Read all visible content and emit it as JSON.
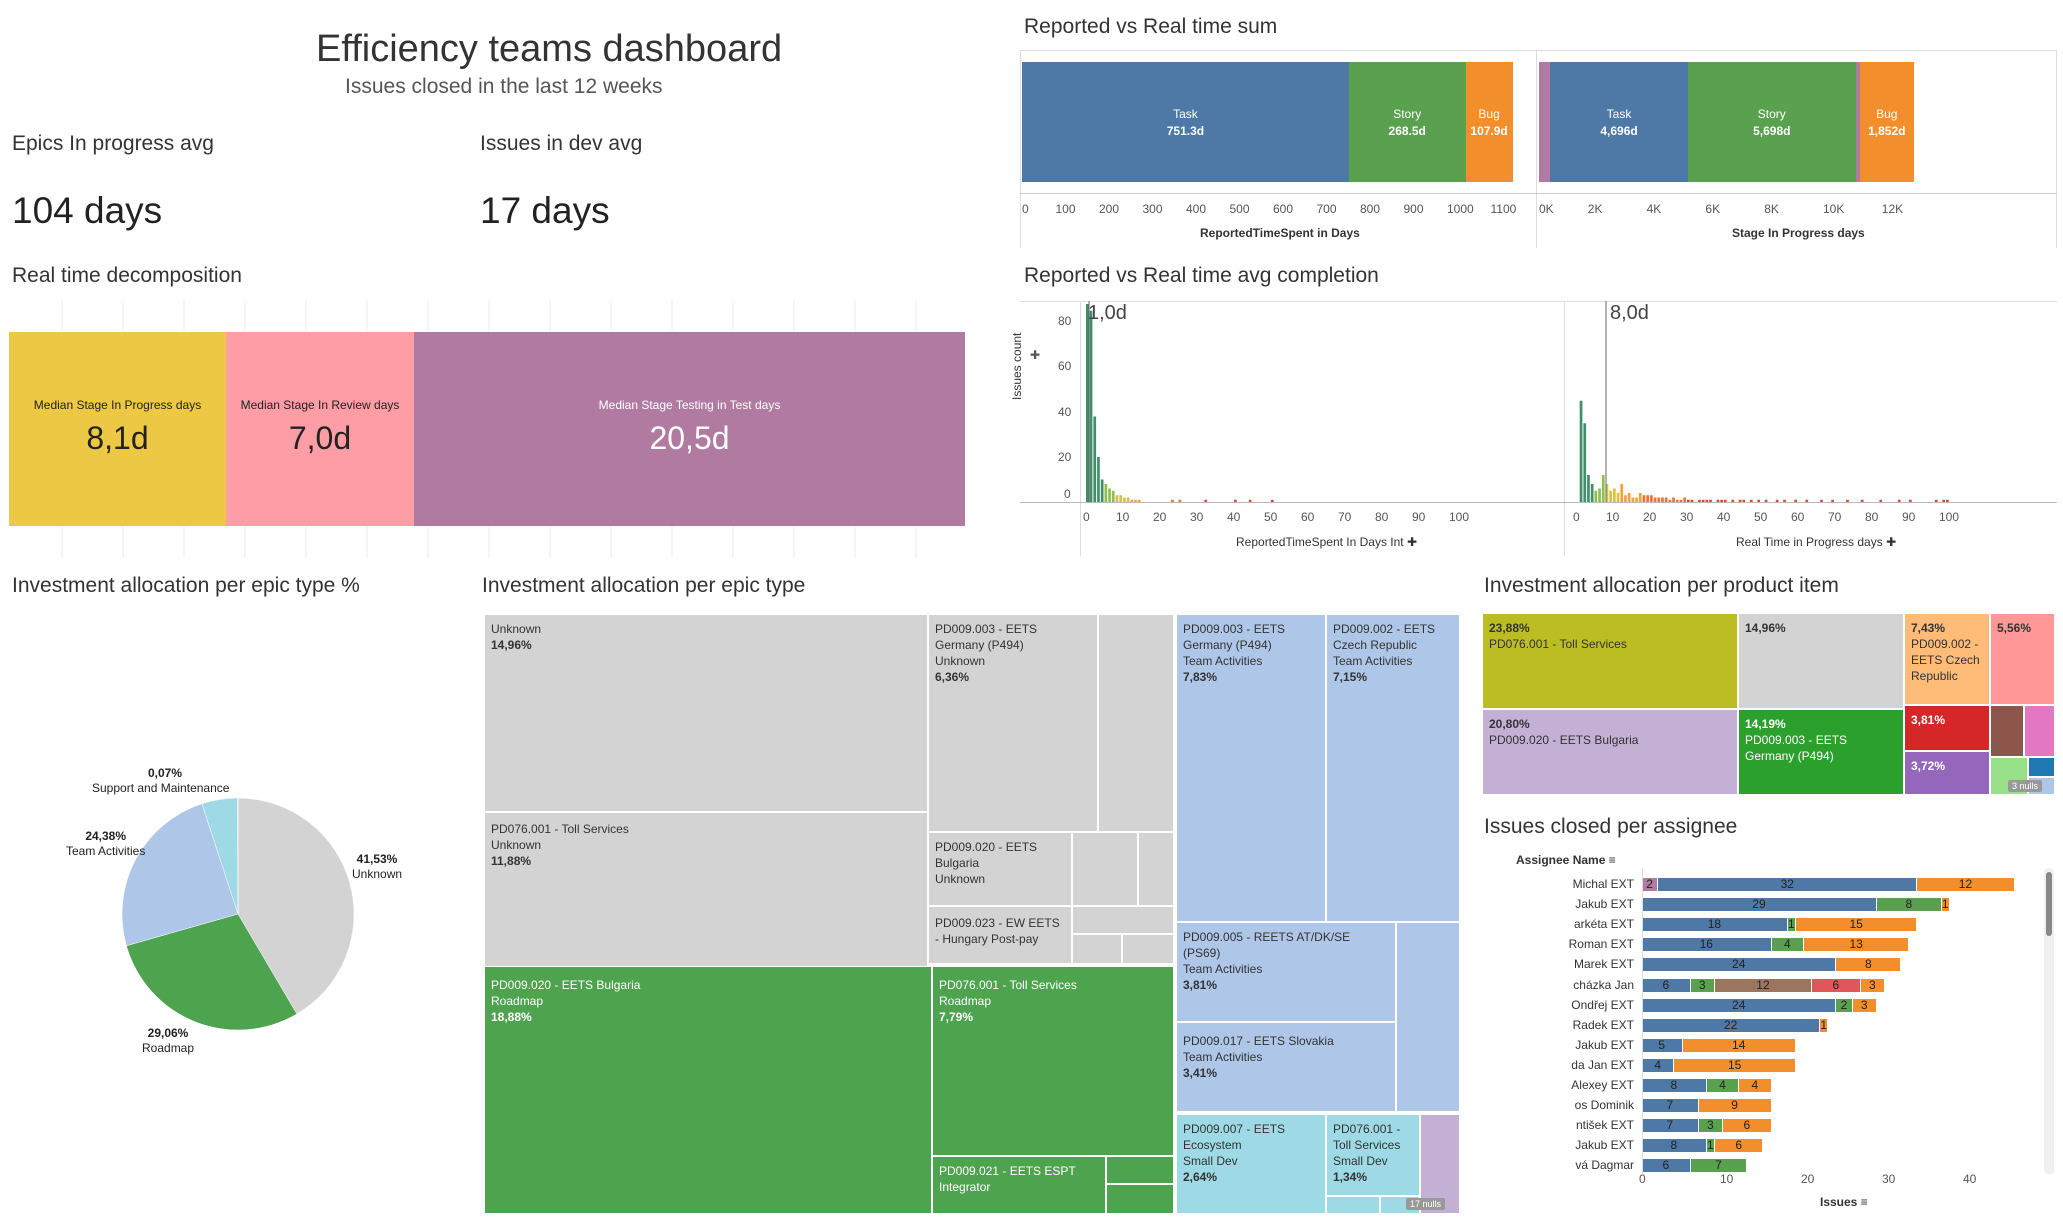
{
  "header": {
    "title": "Efficiency teams dashboard",
    "subtitle": "Issues closed in the last 12 weeks"
  },
  "kpis": {
    "epics_label": "Epics In progress avg",
    "epics_value": "104 days",
    "issues_label": "Issues in dev avg",
    "issues_value": "17 days"
  },
  "decomposition": {
    "title": "Real time decomposition",
    "segments": [
      {
        "label": "Median Stage In Progress days",
        "value": "8,1d",
        "color": "#ecc844"
      },
      {
        "label": "Median Stage In Review days",
        "value": "7,0d",
        "color": "#ff9da6"
      },
      {
        "label": "Median Stage Testing in Test days",
        "value": "20,5d",
        "color": "#b07aa1"
      }
    ]
  },
  "reported_sum": {
    "title": "Reported vs Real time sum",
    "left": {
      "segments": [
        {
          "name": "Task",
          "value": "751.3d",
          "days": 751.3,
          "color": "#4e79a7"
        },
        {
          "name": "Story",
          "value": "268.5d",
          "days": 268.5,
          "color": "#59a14f"
        },
        {
          "name": "Bug",
          "value": "107.9d",
          "days": 107.9,
          "color": "#f28e2b"
        }
      ],
      "ticks": [
        "0",
        "100",
        "200",
        "300",
        "400",
        "500",
        "600",
        "700",
        "800",
        "900",
        "1000",
        "1100"
      ],
      "axis_title": "ReportedTimeSpent in Days"
    },
    "right": {
      "segments": [
        {
          "name": "Task",
          "value": "4,696d",
          "days": 4696,
          "color": "#4e79a7"
        },
        {
          "name": "Story",
          "value": "5,698d",
          "days": 5698,
          "color": "#59a14f"
        },
        {
          "name": "Bug",
          "value": "1,852d",
          "days": 1852,
          "color": "#f28e2b"
        }
      ],
      "ticks": [
        "0K",
        "2K",
        "4K",
        "6K",
        "8K",
        "10K",
        "12K"
      ],
      "axis_title": "Stage In Progress days"
    }
  },
  "avg_completion": {
    "title": "Reported vs Real time avg completion",
    "y_title": "Issues count",
    "y_ticks": [
      "80",
      "60",
      "40",
      "20",
      "0"
    ],
    "left": {
      "marker": "1,0d",
      "ticks": [
        "0",
        "10",
        "20",
        "30",
        "40",
        "50",
        "60",
        "70",
        "80",
        "90",
        "100"
      ],
      "axis_title": "ReportedTimeSpent In Days Int"
    },
    "right": {
      "marker": "8,0d",
      "ticks": [
        "0",
        "10",
        "20",
        "30",
        "40",
        "50",
        "60",
        "70",
        "80",
        "90",
        "100"
      ],
      "axis_title": "Real Time in Progress days"
    }
  },
  "pie": {
    "title": "Investment allocation per epic type %",
    "slices": [
      {
        "pct": "41,53%",
        "name": "Unknown",
        "value": 41.53,
        "color": "#d3d3d3"
      },
      {
        "pct": "29,06%",
        "name": "Roadmap",
        "value": 29.06,
        "color": "#4ea34f"
      },
      {
        "pct": "24,38%",
        "name": "Team Activities",
        "value": 24.38,
        "color": "#aec7e8"
      },
      {
        "pct": "",
        "name": "",
        "value": 4.96,
        "color": "#9edae5"
      },
      {
        "pct": "0,07%",
        "name": "Support and Maintenance",
        "value": 0.07,
        "color": "#c5b0d5"
      }
    ]
  },
  "treemap_epic": {
    "title": "Investment allocation per epic type",
    "cells": [
      {
        "text": "Unknown",
        "pct": "14,96%"
      },
      {
        "text": "PD009.003 - EETS\nGermany (P494)\nUnknown",
        "pct": "6,36%"
      },
      {
        "text": "PD076.001 - Toll Services\nUnknown",
        "pct": "11,88%"
      },
      {
        "text": "PD009.020 - EETS\nBulgaria\nUnknown",
        "pct": ""
      },
      {
        "text": "PD009.023 - EW EETS\n- Hungary Post-pay",
        "pct": ""
      },
      {
        "text": "PD009.020 - EETS Bulgaria\nRoadmap",
        "pct": "18,88%"
      },
      {
        "text": "PD076.001 - Toll Services\nRoadmap",
        "pct": "7,79%"
      },
      {
        "text": "PD009.021 - EETS ESPT\nIntegrator",
        "pct": ""
      },
      {
        "text": "PD009.003 - EETS\nGermany (P494)\nTeam Activities",
        "pct": "7,83%"
      },
      {
        "text": "PD009.002 - EETS\nCzech Republic\nTeam Activities",
        "pct": "7,15%"
      },
      {
        "text": "PD009.005 - REETS AT/DK/SE\n(PS69)\nTeam Activities",
        "pct": "3,81%"
      },
      {
        "text": "PD009.017 - EETS Slovakia\nTeam Activities",
        "pct": "3,41%"
      },
      {
        "text": "PD009.007 - EETS\nEcosystem\nSmall Dev",
        "pct": "2,64%"
      },
      {
        "text": "PD076.001 -\nToll Services\nSmall Dev",
        "pct": "1,34%"
      }
    ],
    "nulls": "17 nulls"
  },
  "treemap_product": {
    "title": "Investment allocation per product item",
    "cells": [
      {
        "pct": "23,88%",
        "text": "PD076.001 - Toll Services"
      },
      {
        "pct": "14,96%",
        "text": ""
      },
      {
        "pct": "7,43%",
        "text": "PD009.002 -\nEETS Czech\nRepublic"
      },
      {
        "pct": "5,56%",
        "text": ""
      },
      {
        "pct": "20,80%",
        "text": "PD009.020 - EETS Bulgaria"
      },
      {
        "pct": "14,19%",
        "text": "PD009.003 - EETS\nGermany (P494)"
      },
      {
        "pct": "3,81%",
        "text": ""
      },
      {
        "pct": "3,72%",
        "text": ""
      }
    ],
    "nulls": "3 nulls"
  },
  "assignee": {
    "title": "Issues closed per assignee",
    "header": "Assignee Name",
    "x_title": "Issues",
    "x_ticks": [
      "0",
      "10",
      "20",
      "30",
      "40"
    ],
    "rows": [
      {
        "name": "Michal EXT",
        "segs": [
          [
            2,
            "#b07aa1"
          ],
          [
            32,
            "#4e79a7"
          ],
          [
            12,
            "#f28e2b"
          ]
        ]
      },
      {
        "name": "Jakub EXT",
        "segs": [
          [
            29,
            "#4e79a7"
          ],
          [
            8,
            "#59a14f"
          ],
          [
            1,
            "#f28e2b"
          ]
        ]
      },
      {
        "name": "arkéta EXT",
        "segs": [
          [
            18,
            "#4e79a7"
          ],
          [
            1,
            "#59a14f"
          ],
          [
            15,
            "#f28e2b"
          ]
        ]
      },
      {
        "name": "Roman EXT",
        "segs": [
          [
            16,
            "#4e79a7"
          ],
          [
            4,
            "#59a14f"
          ],
          [
            13,
            "#f28e2b"
          ]
        ]
      },
      {
        "name": "Marek EXT",
        "segs": [
          [
            24,
            "#4e79a7"
          ],
          [
            8,
            "#f28e2b"
          ]
        ]
      },
      {
        "name": "cházka Jan",
        "segs": [
          [
            6,
            "#4e79a7"
          ],
          [
            3,
            "#59a14f"
          ],
          [
            12,
            "#9c755f"
          ],
          [
            6,
            "#e15759"
          ],
          [
            3,
            "#f28e2b"
          ]
        ]
      },
      {
        "name": "Ondřej EXT",
        "segs": [
          [
            24,
            "#4e79a7"
          ],
          [
            2,
            "#59a14f"
          ],
          [
            3,
            "#f28e2b"
          ]
        ]
      },
      {
        "name": "Radek EXT",
        "segs": [
          [
            22,
            "#4e79a7"
          ],
          [
            1,
            "#f28e2b"
          ]
        ]
      },
      {
        "name": "Jakub EXT",
        "segs": [
          [
            5,
            "#4e79a7"
          ],
          [
            14,
            "#f28e2b"
          ]
        ]
      },
      {
        "name": "da Jan EXT",
        "segs": [
          [
            4,
            "#4e79a7"
          ],
          [
            15,
            "#f28e2b"
          ]
        ]
      },
      {
        "name": "Alexey EXT",
        "segs": [
          [
            8,
            "#4e79a7"
          ],
          [
            4,
            "#59a14f"
          ],
          [
            4,
            "#f28e2b"
          ]
        ]
      },
      {
        "name": "os Dominik",
        "segs": [
          [
            7,
            "#4e79a7"
          ],
          [
            9,
            "#f28e2b"
          ]
        ]
      },
      {
        "name": "ntišek EXT",
        "segs": [
          [
            7,
            "#4e79a7"
          ],
          [
            3,
            "#59a14f"
          ],
          [
            6,
            "#f28e2b"
          ]
        ]
      },
      {
        "name": "Jakub EXT",
        "segs": [
          [
            8,
            "#4e79a7"
          ],
          [
            1,
            "#59a14f"
          ],
          [
            6,
            "#f28e2b"
          ]
        ]
      },
      {
        "name": "vá Dagmar",
        "segs": [
          [
            6,
            "#4e79a7"
          ],
          [
            7,
            "#59a14f"
          ]
        ]
      }
    ]
  }
}
